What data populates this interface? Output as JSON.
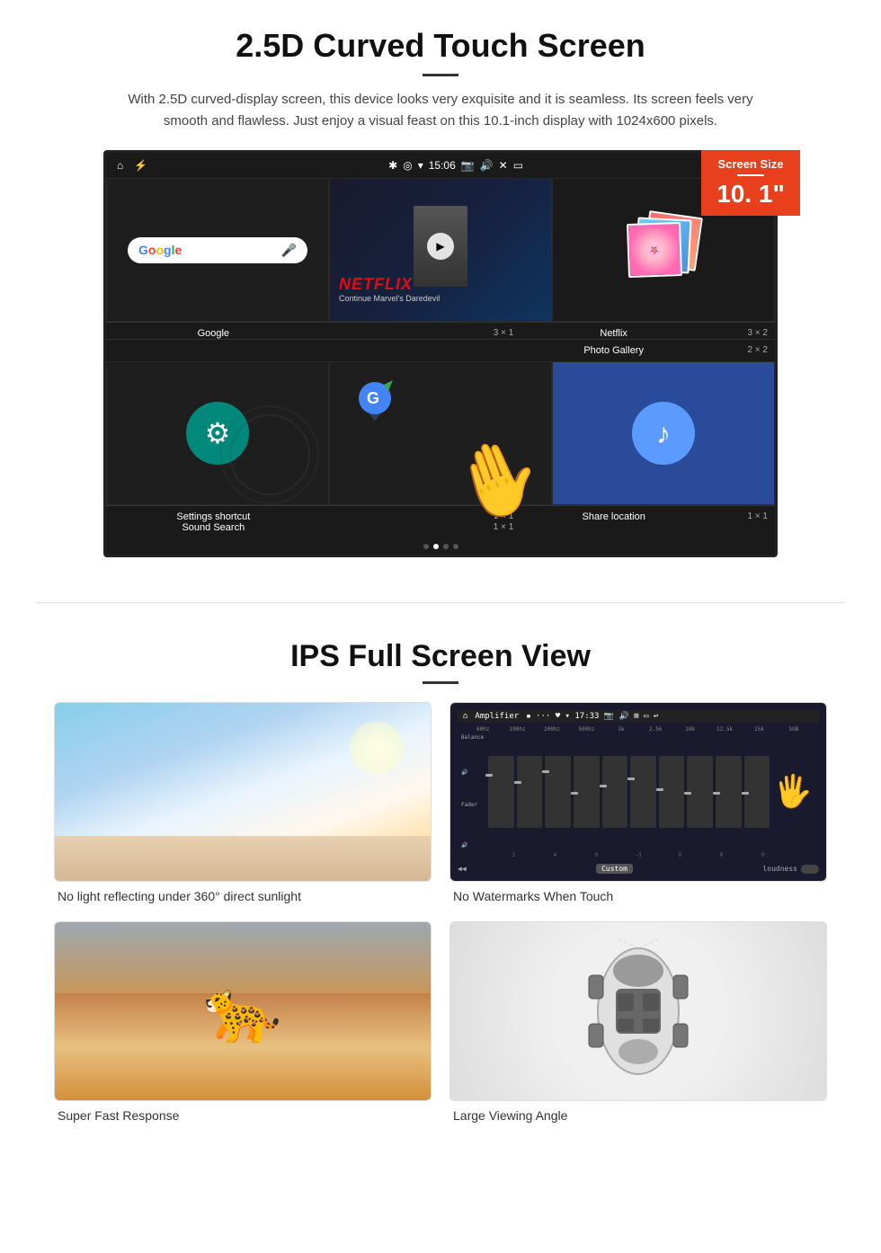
{
  "section1": {
    "title": "2.5D Curved Touch Screen",
    "description": "With 2.5D curved-display screen, this device looks very exquisite and it is seamless. Its screen feels very smooth and flawless. Just enjoy a visual feast on this 10.1-inch display with 1024x600 pixels.",
    "screen_size_badge": {
      "title": "Screen Size",
      "size": "10. 1\""
    },
    "status_bar": {
      "time": "15:06"
    },
    "apps": [
      {
        "name": "Google",
        "size": "3 × 1"
      },
      {
        "name": "Netflix",
        "size": "3 × 2"
      },
      {
        "name": "Photo Gallery",
        "size": "2 × 2"
      },
      {
        "name": "Settings shortcut",
        "size": "1 × 1"
      },
      {
        "name": "Share location",
        "size": "1 × 1"
      },
      {
        "name": "Sound Search",
        "size": "1 × 1"
      }
    ],
    "netflix_text": "NETFLIX",
    "netflix_subtitle": "Continue Marvel's Daredevil"
  },
  "section2": {
    "title": "IPS Full Screen View",
    "features": [
      {
        "id": "sunlight",
        "label": "No light reflecting under 360° direct sunlight"
      },
      {
        "id": "watermarks",
        "label": "No Watermarks When Touch"
      },
      {
        "id": "response",
        "label": "Super Fast Response"
      },
      {
        "id": "viewing",
        "label": "Large Viewing Angle"
      }
    ]
  }
}
